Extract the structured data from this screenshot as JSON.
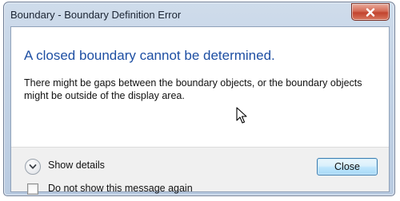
{
  "window": {
    "title": "Boundary - Boundary Definition Error",
    "close_glyph": "x"
  },
  "dialog": {
    "main_instruction": "A closed boundary cannot be determined.",
    "content": "There might be gaps between the boundary objects, or the boundary objects might be outside of the display area."
  },
  "footer": {
    "details_label": "Show details",
    "checkbox_label": "Do not show this message again",
    "checkbox_checked": false,
    "close_button_label": "Close"
  },
  "colors": {
    "main_instruction": "#1e4fa3",
    "title_close_button": "#c2432d",
    "default_button_border": "#3c7fb1"
  },
  "icons": {
    "window_close": "close-icon",
    "details_toggle": "chevron-down-icon",
    "pointer": "mouse-cursor-icon"
  }
}
